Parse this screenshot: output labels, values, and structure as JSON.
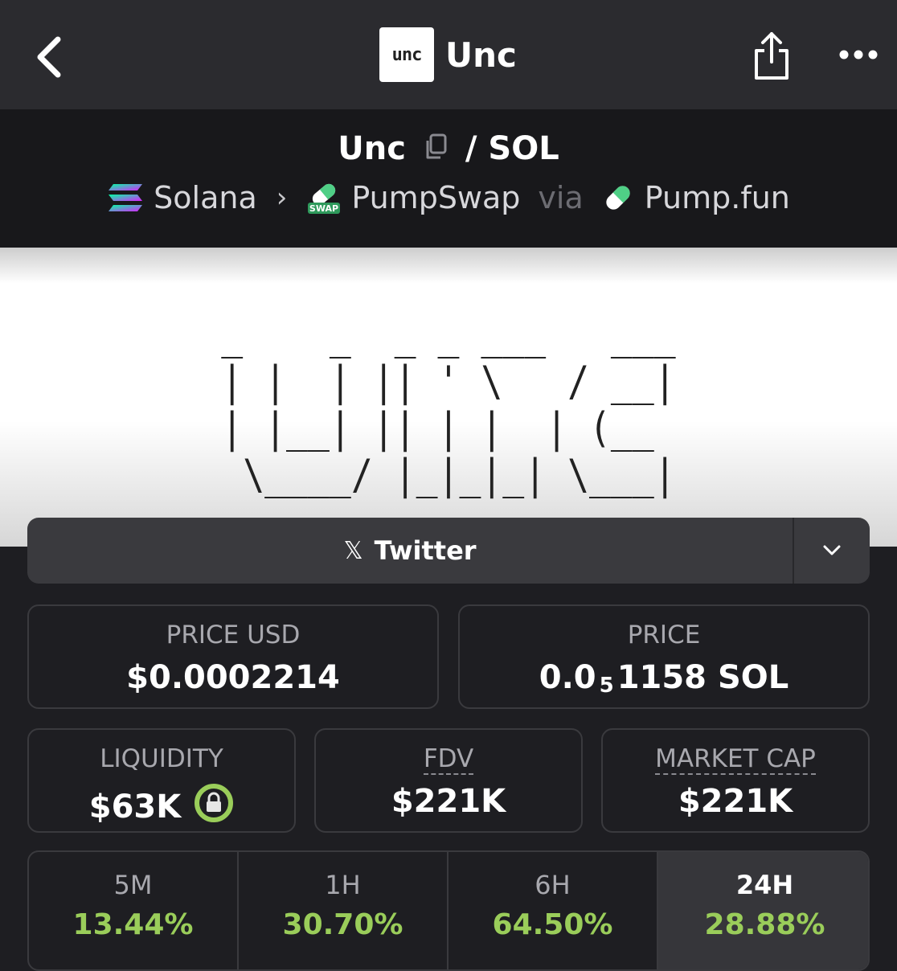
{
  "nav": {
    "title": "Unc",
    "logo_text": "unc"
  },
  "pair": {
    "base": "Unc",
    "separator": "/",
    "quote": "SOL",
    "chain": "Solana",
    "dex": "PumpSwap",
    "via_label": "via",
    "launchpad": "Pump.fun"
  },
  "banner": {
    "ascii_art": " _    _  _ _ ___   ___ \n| |  | || ' \\   / __|\n| |__| || | |  | (__ \n \\____/ |_|_|_| \\___|"
  },
  "twitter": {
    "label": "Twitter",
    "icon": "x-logo-icon"
  },
  "price_usd": {
    "label": "PRICE USD",
    "value": "$0.0002214"
  },
  "price": {
    "label": "PRICE",
    "prefix": "0.0",
    "subscript": "5",
    "suffix": "1158 SOL"
  },
  "liquidity": {
    "label": "LIQUIDITY",
    "value": "$63K",
    "lock_color": "#9acd5a"
  },
  "fdv": {
    "label": "FDV",
    "value": "$221K"
  },
  "market_cap": {
    "label": "MARKET CAP",
    "value": "$221K"
  },
  "changes": [
    {
      "label": "5M",
      "value": "13.44%"
    },
    {
      "label": "1H",
      "value": "30.70%"
    },
    {
      "label": "6H",
      "value": "64.50%"
    },
    {
      "label": "24H",
      "value": "28.88%",
      "selected": true
    }
  ],
  "colors": {
    "positive": "#9acd5a",
    "background": "#1e1e22"
  }
}
